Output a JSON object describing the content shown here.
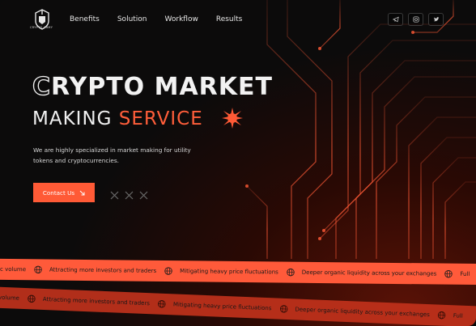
{
  "header": {
    "logo_text": "CRYPTO ARMY",
    "nav": [
      "Benefits",
      "Solution",
      "Workflow",
      "Results"
    ],
    "socials": [
      "telegram-icon",
      "instagram-icon",
      "twitter-icon"
    ]
  },
  "hero": {
    "title_first": "C",
    "title_rest": "RYPTO MARKET",
    "subtitle_white": "MAKING",
    "subtitle_orange": "SERVICE",
    "description": "We are highly specialized in market making for utility tokens and cryptocurrencies.",
    "cta_label": "Contact Us"
  },
  "ticker_top": [
    "c volume",
    "Attracting more investors and traders",
    "Mitigating heavy price fluctuations",
    "Deeper organic liquidity across your exchanges",
    "Full"
  ],
  "ticker_bottom": [
    "volume",
    "Attracting more investors and traders",
    "Mitigating heavy price fluctuations",
    "Deeper organic liquidity across your exchanges",
    "Full"
  ],
  "colors": {
    "accent": "#ff5a36",
    "background": "#0b0b0b"
  }
}
